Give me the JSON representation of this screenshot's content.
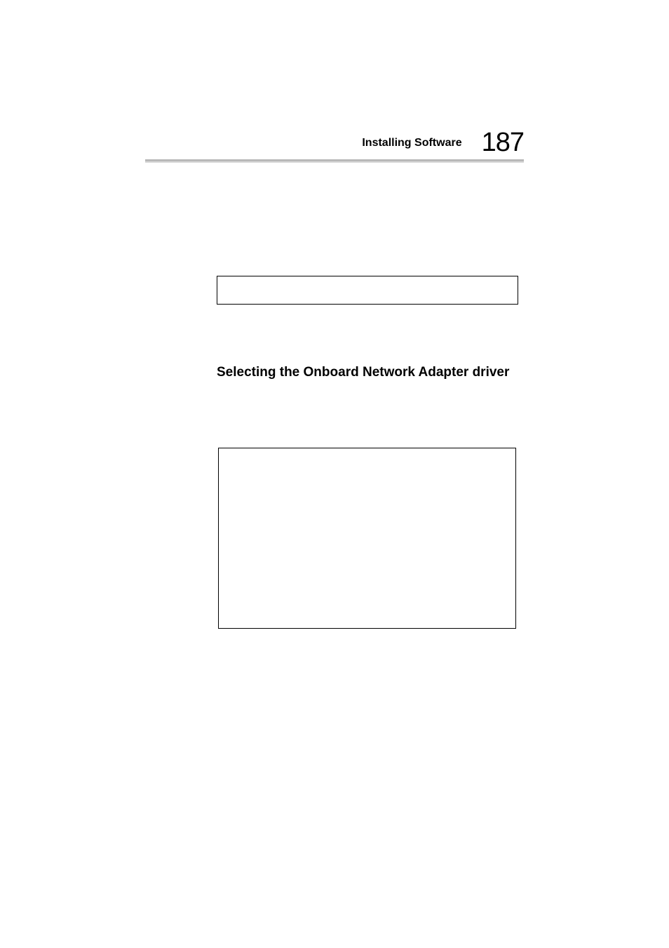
{
  "header": {
    "section": "Installing Software",
    "page_number": "187"
  },
  "subheading": "Selecting the Onboard Network Adapter driver"
}
